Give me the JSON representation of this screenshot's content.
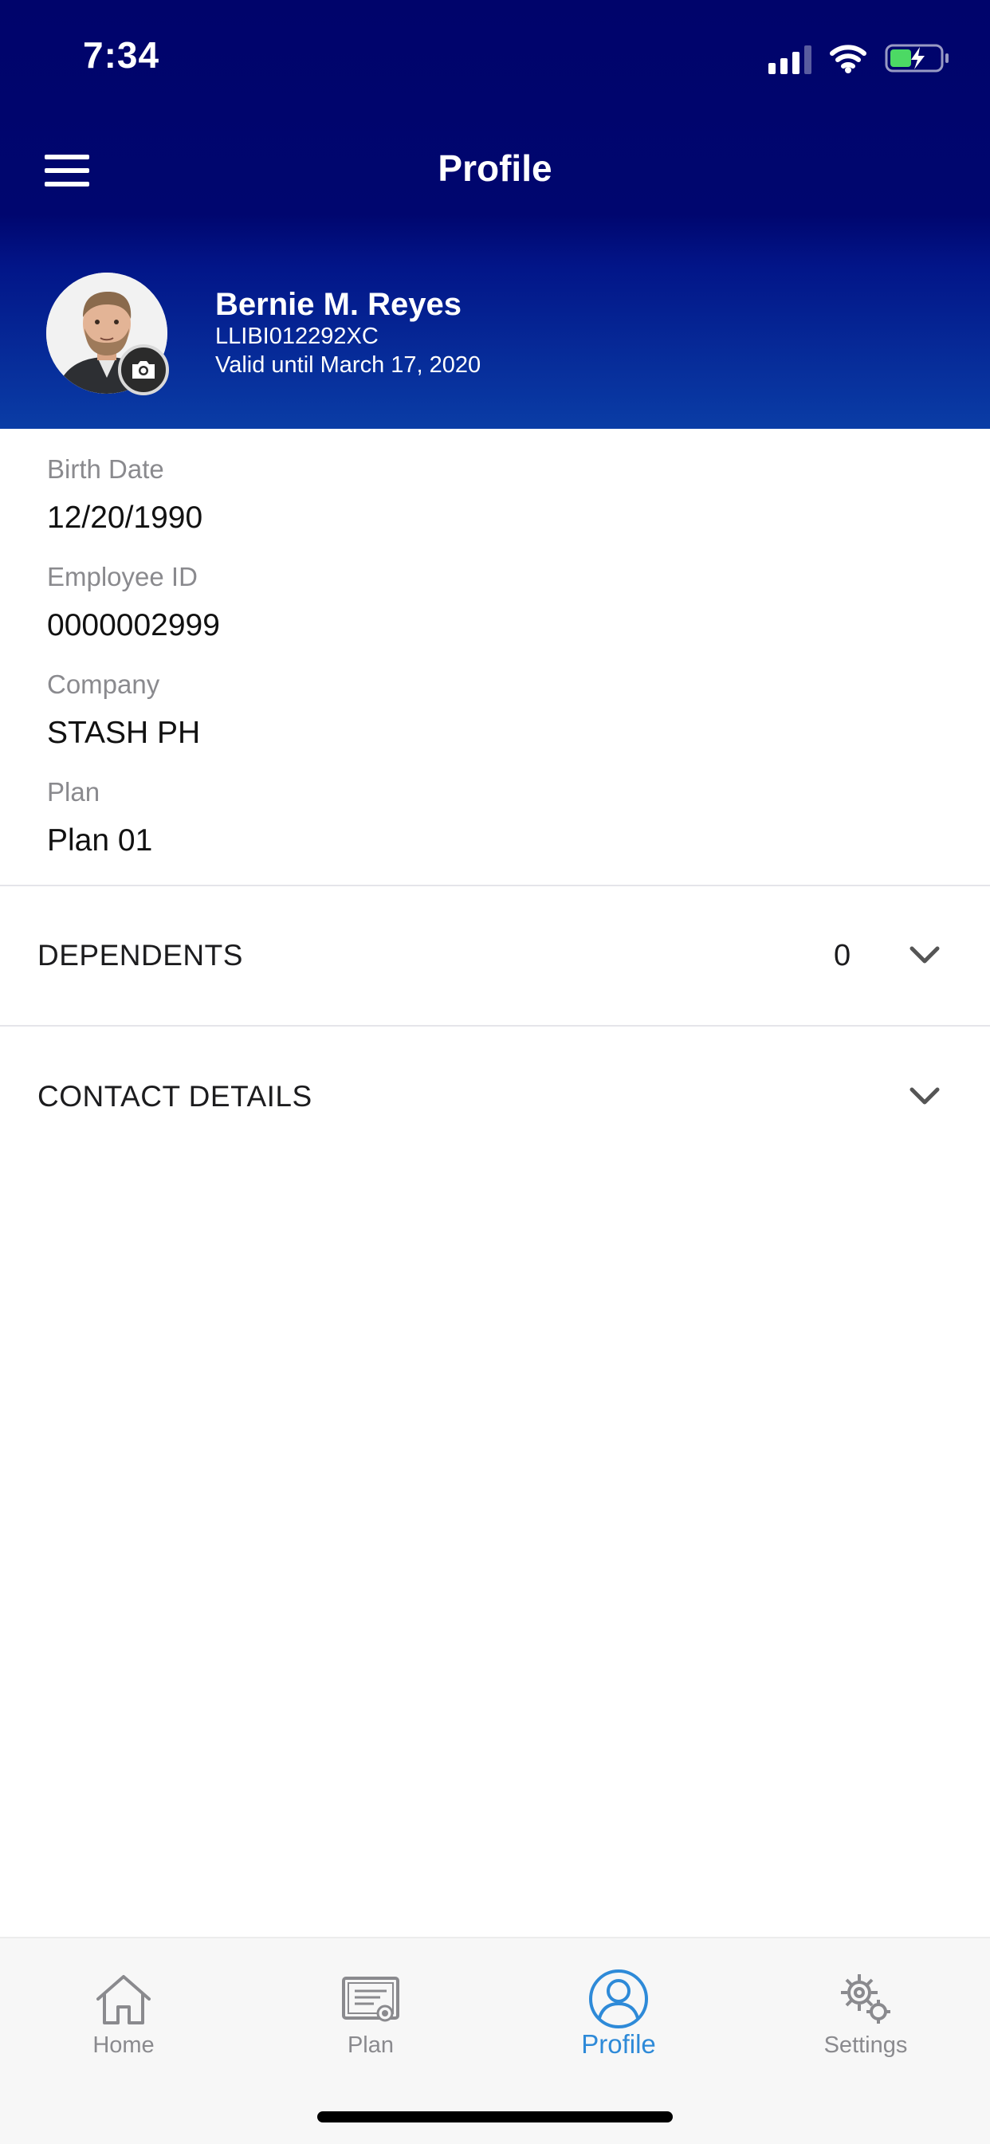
{
  "status_bar": {
    "time": "7:34",
    "icons": [
      "cellular-signal-icon",
      "wifi-icon",
      "battery-charging-icon"
    ]
  },
  "header": {
    "title": "Profile",
    "menu_icon": "hamburger-menu-icon"
  },
  "profile": {
    "name": "Bernie M. Reyes",
    "member_code": "LLIBI012292XC",
    "validity": "Valid until March 17, 2020",
    "camera_icon": "camera-icon"
  },
  "details": [
    {
      "label": "Birth Date",
      "value": "12/20/1990"
    },
    {
      "label": "Employee ID",
      "value": "0000002999"
    },
    {
      "label": "Company",
      "value": "STASH PH"
    },
    {
      "label": "Plan",
      "value": "Plan 01"
    }
  ],
  "sections": {
    "dependents": {
      "title": "DEPENDENTS",
      "count": "0"
    },
    "contact_details": {
      "title": "CONTACT DETAILS"
    }
  },
  "tabbar": {
    "items": [
      {
        "label": "Home",
        "icon": "home-icon",
        "active": false
      },
      {
        "label": "Plan",
        "icon": "plan-certificate-icon",
        "active": false
      },
      {
        "label": "Profile",
        "icon": "user-profile-icon",
        "active": true
      },
      {
        "label": "Settings",
        "icon": "settings-gear-icon",
        "active": false
      }
    ]
  },
  "colors": {
    "header_dark": "#00046b",
    "header_light": "#0a3da6",
    "active_tab": "#2e8ad8",
    "inactive_tab": "#8a8a8e",
    "battery_fill": "#4cd964"
  }
}
